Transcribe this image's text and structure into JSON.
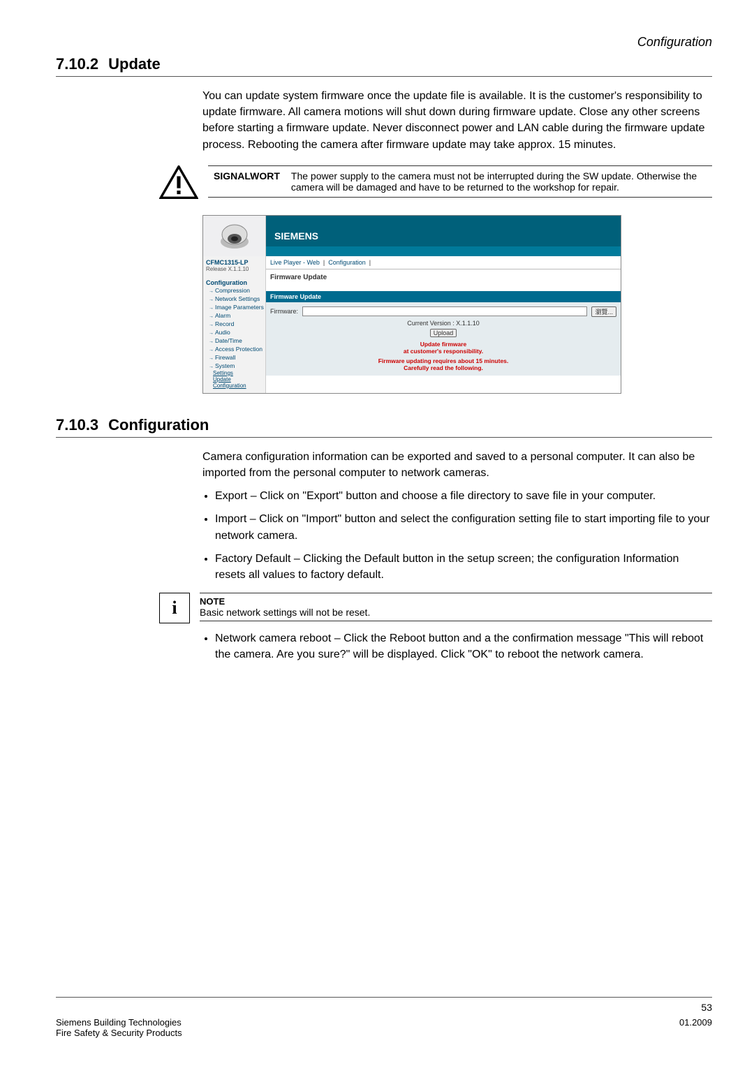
{
  "header_label": "Configuration",
  "sec1": {
    "num": "7.10.2",
    "title": "Update"
  },
  "update_para": "You can update system firmware once the update file is available. It is the customer's responsibility to update firmware. All camera motions will shut down during firmware update. Close any other screens before starting a firmware update. Never disconnect power and LAN cable during the firmware update process. Rebooting the camera after firmware update may take approx. 15 minutes.",
  "signal": {
    "label": "SIGNALWORT",
    "text": "The power supply to the camera must not be interrupted during the SW update. Otherwise the camera will be damaged and have to be returned to the workshop for repair."
  },
  "shot": {
    "brand": "SIEMENS",
    "model": "CFMC1315-LP",
    "release": "Release X.1.1.10",
    "nav_header": "Configuration",
    "nav_items": [
      "Compression",
      "Network Settings",
      "Image Parameters",
      "Alarm",
      "Record",
      "Audio",
      "Date/Time",
      "Access Protection",
      "Firewall",
      "System"
    ],
    "nav_subs": [
      "Settings",
      "Update",
      "Configuration"
    ],
    "crumb_live": "Live Player - Web",
    "crumb_conf": "Configuration",
    "page_title": "Firmware Update",
    "panel_title": "Firmware Update",
    "firmware_label": "Firmware:",
    "browse": "瀏覽...",
    "current_version": "Current Version : X.1.1.10",
    "upload": "Upload",
    "red1": "Update firmware",
    "red2": "at customer's responsibility.",
    "red3": "Firmware updating requires about 15 minutes.",
    "red4": "Carefully read the following."
  },
  "sec2": {
    "num": "7.10.3",
    "title": "Configuration"
  },
  "conf_para": "Camera configuration information can be exported and saved to a personal computer. It can also be imported from the personal computer to network cameras.",
  "bullets": [
    "Export – Click on \"Export\" button and choose a file directory to save file in your computer.",
    "Import – Click on \"Import\" button and select the configuration setting file to start importing file to your network camera.",
    "Factory Default – Clicking the Default button in the setup screen; the configuration Information resets all values to factory default."
  ],
  "note": {
    "title": "NOTE",
    "text": "Basic network settings will not be reset."
  },
  "bullet_reboot": "Network camera reboot – Click the Reboot button and a the confirmation message \"This will reboot the camera. Are you sure?\" will be displayed. Click \"OK\" to reboot the network camera.",
  "footer": {
    "page": "53",
    "left1": "Siemens Building Technologies",
    "left2": "Fire Safety & Security Products",
    "right": "01.2009"
  }
}
